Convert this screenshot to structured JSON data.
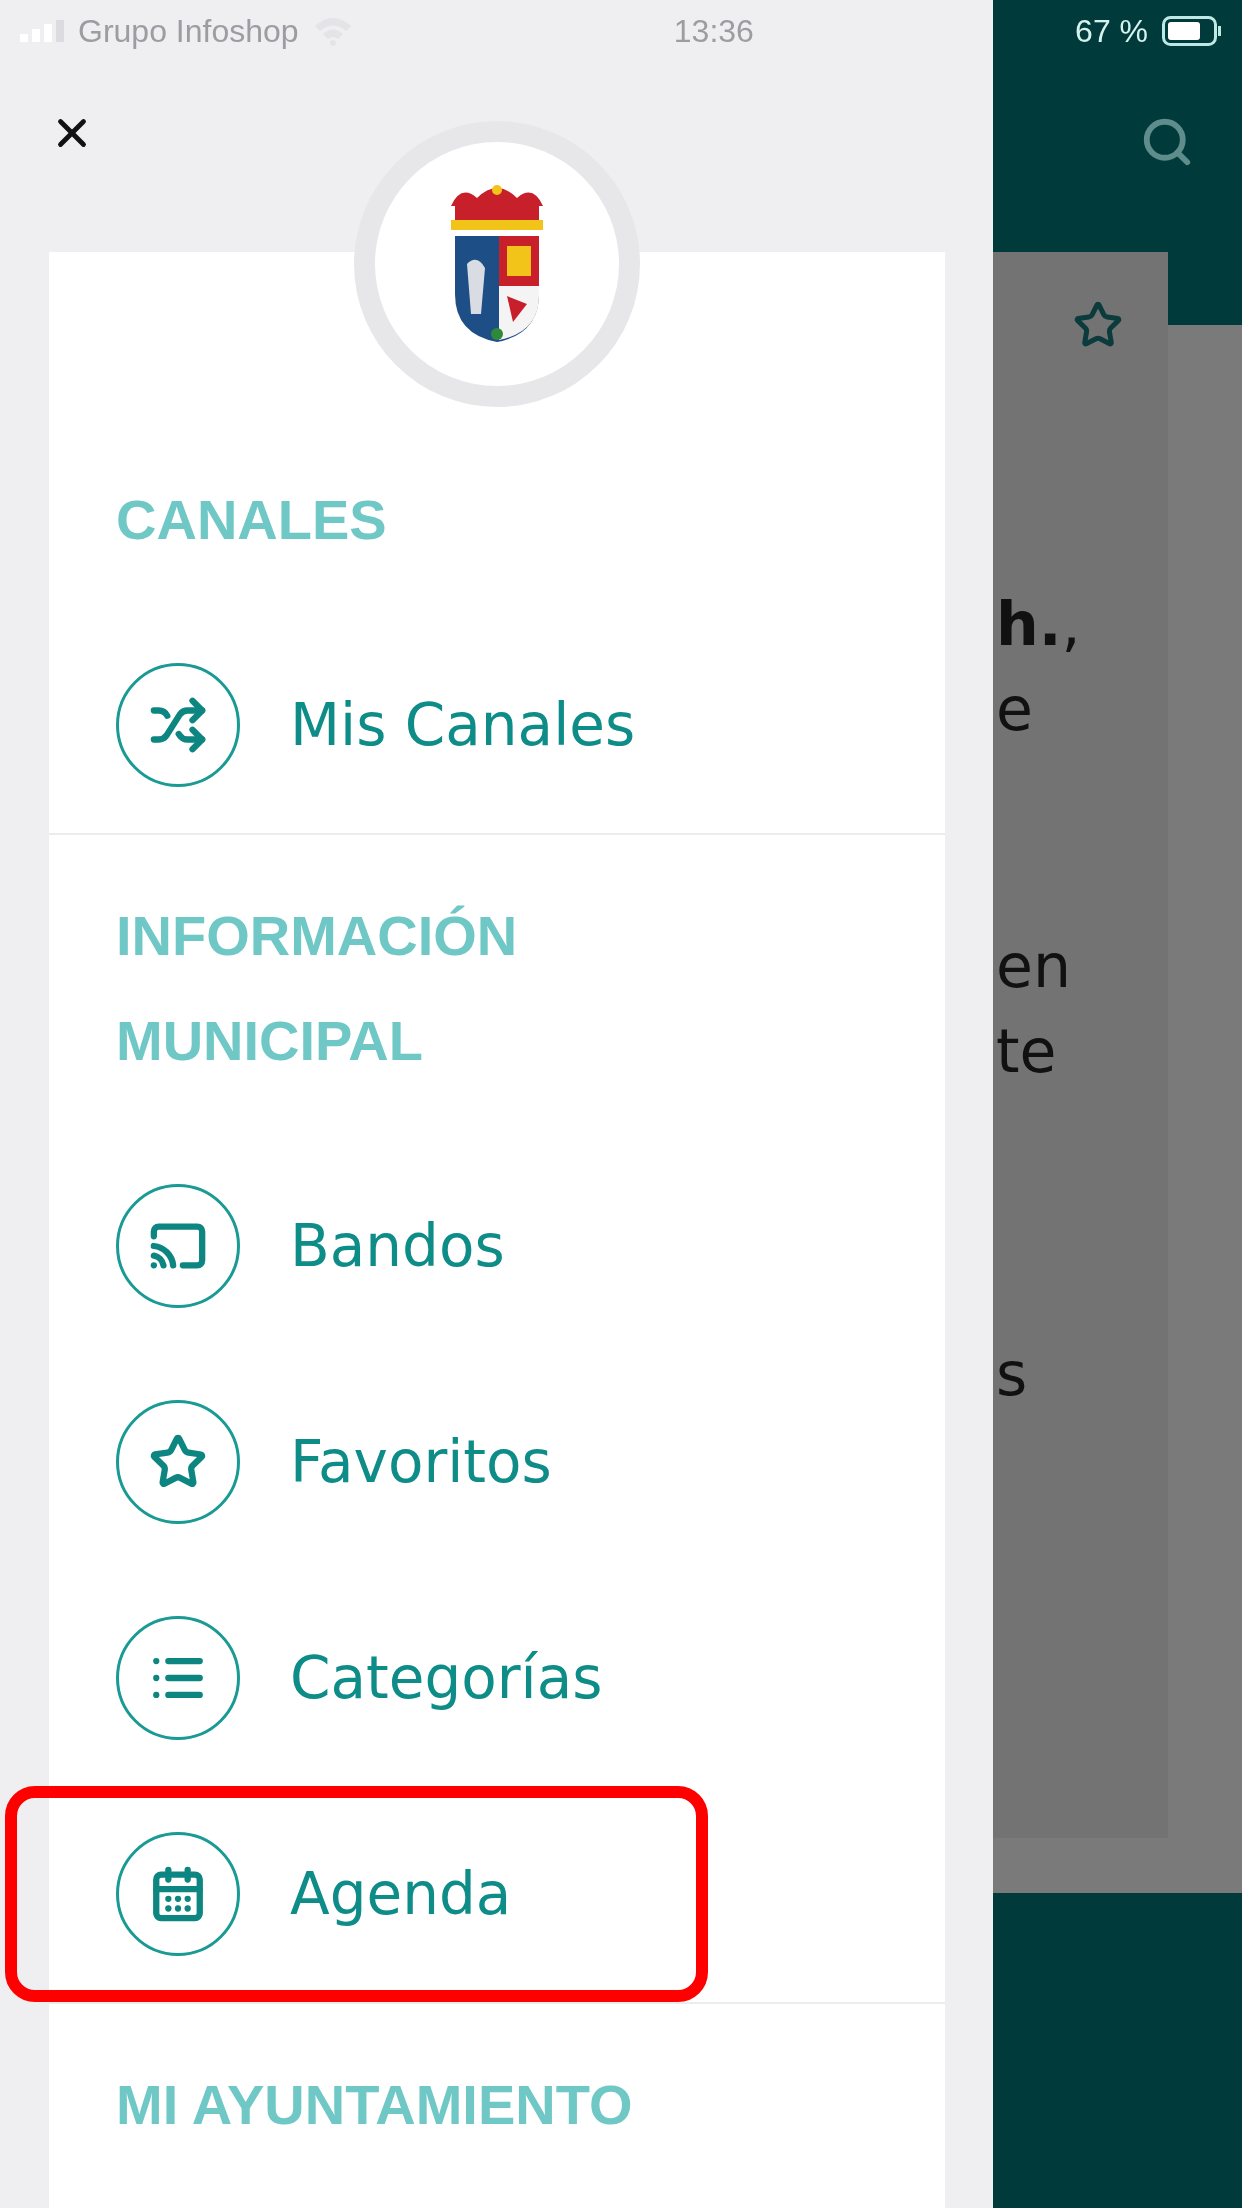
{
  "status_bar": {
    "carrier": "Grupo Infoshop",
    "time": "13:36",
    "battery": "67 %"
  },
  "drawer": {
    "sections": [
      {
        "title": "CANALES",
        "items": [
          {
            "label": "Mis Canales",
            "highlighted": false
          }
        ]
      },
      {
        "title": "INFORMACIÓN MUNICIPAL",
        "items": [
          {
            "label": "Bandos",
            "highlighted": false
          },
          {
            "label": "Favoritos",
            "highlighted": false
          },
          {
            "label": "Categorías",
            "highlighted": false
          },
          {
            "label": "Agenda",
            "highlighted": true
          }
        ]
      },
      {
        "title": "MI AYUNTAMIENTO"
      }
    ]
  },
  "background_content": {
    "paragraphs": [
      [
        "**h.**,",
        "e"
      ],
      [
        "en",
        "te"
      ],
      [
        "s"
      ]
    ]
  }
}
